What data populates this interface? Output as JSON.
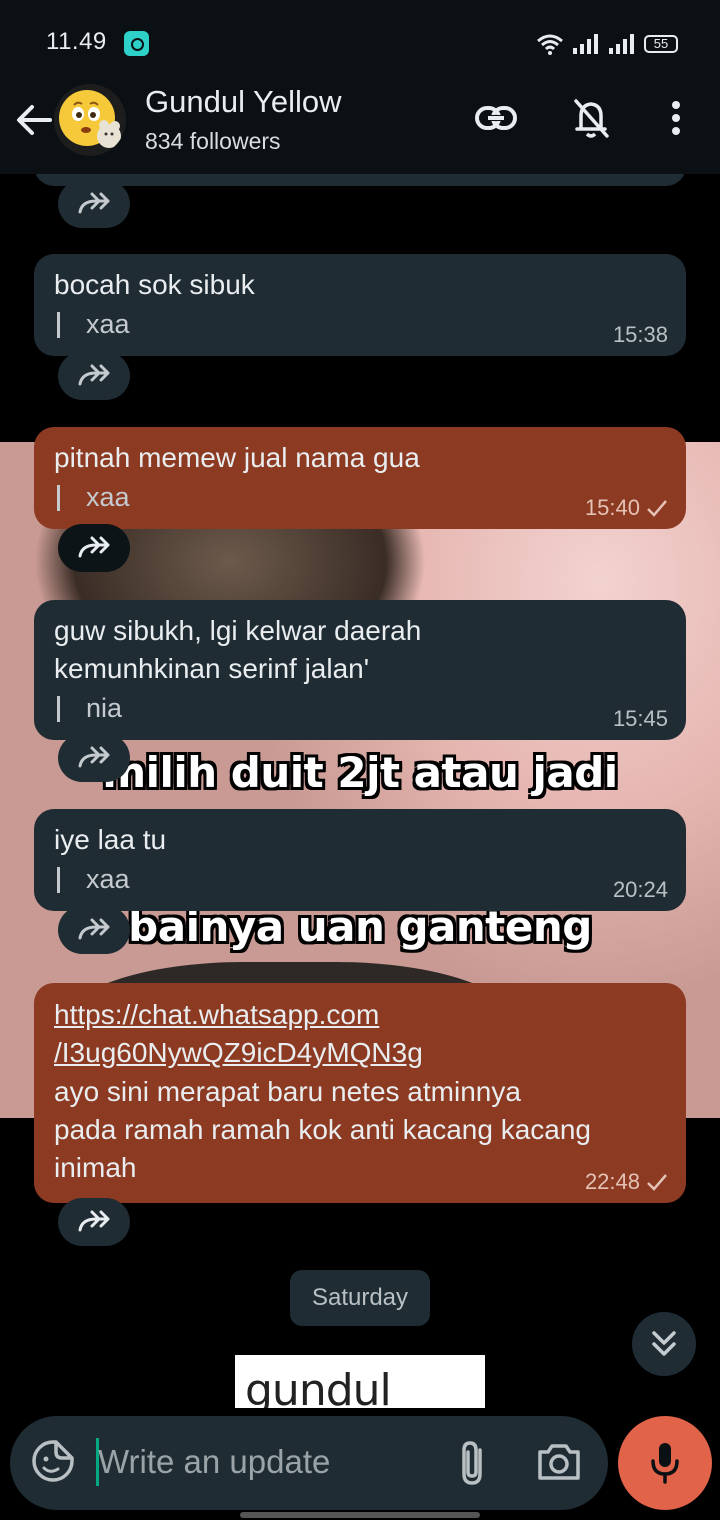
{
  "status_bar": {
    "time": "11.49",
    "battery": "55"
  },
  "header": {
    "channel_name": "Gundul Yellow",
    "followers": "834 followers",
    "icons": [
      "back-arrow-icon",
      "link-icon",
      "bell-off-icon",
      "more-vert-icon"
    ]
  },
  "background_captions": [
    "milih duit 2jt atau jadi",
    "bainya uan ganteng"
  ],
  "messages": [
    {
      "text": "bocah sok sibuk",
      "signature": "xaa",
      "time": "15:38",
      "own": false,
      "sent_check": false
    },
    {
      "text": "pitnah memew jual nama gua",
      "signature": "xaa",
      "time": "15:40",
      "own": true,
      "sent_check": true
    },
    {
      "text": "guw sibukh, lgi kelwar daerah\nkemunhkinan serinf jalan'",
      "signature": "nia",
      "time": "15:45",
      "own": false,
      "sent_check": false
    },
    {
      "text": "iye laa tu",
      "signature": "xaa",
      "time": "20:24",
      "own": false,
      "sent_check": false
    },
    {
      "link_line1": "https://chat.whatsapp.com",
      "link_line2": "/I3ug60NywQZ9icD4yMQN3g",
      "text": "ayo sini merapat baru netes atminnya\npada ramah ramah kok anti kacang kacang\ninimah",
      "time": "22:48",
      "own": true,
      "sent_check": true
    }
  ],
  "day_divider": "Saturday",
  "preview_text": "gundul",
  "composer": {
    "placeholder": "Write an update"
  },
  "colors": {
    "own_bubble": "#8c3a22",
    "other_bubble": "#1f2c33",
    "mic_button": "#e0634a",
    "cursor": "#00a884"
  }
}
